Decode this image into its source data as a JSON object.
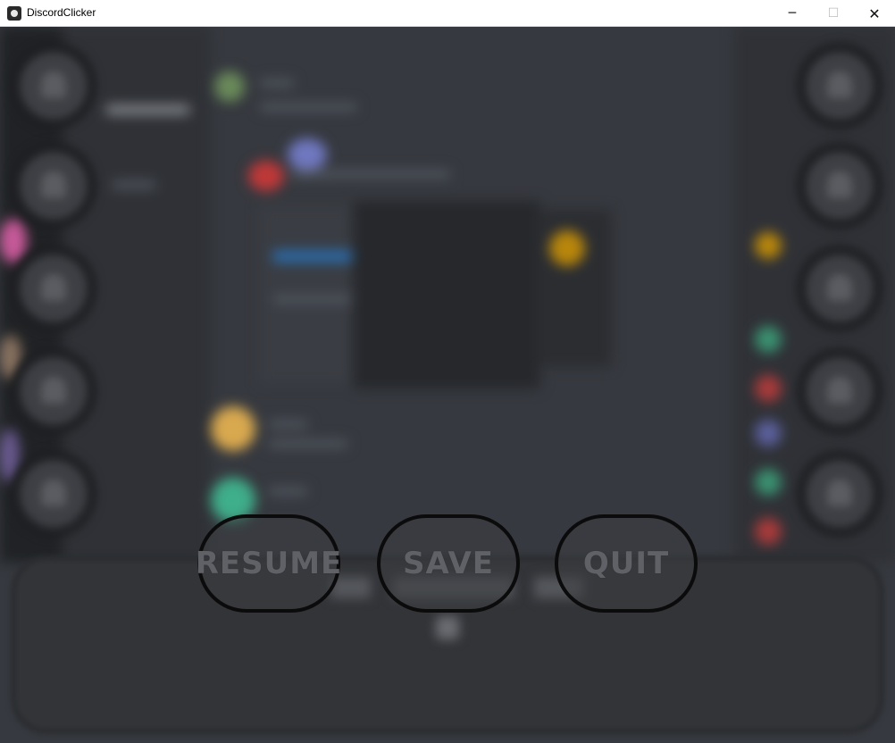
{
  "window": {
    "title": "DiscordClicker",
    "icon": "app-logo-icon",
    "controls": {
      "minimize": "─",
      "maximize": "☐",
      "close": "✕"
    }
  },
  "pause_menu": {
    "resume_label": "RESUME",
    "save_label": "SAVE",
    "quit_label": "QUIT"
  },
  "colors": {
    "background": "#36393f",
    "button_border": "#0b0b0b",
    "button_text": "#5f6166"
  }
}
